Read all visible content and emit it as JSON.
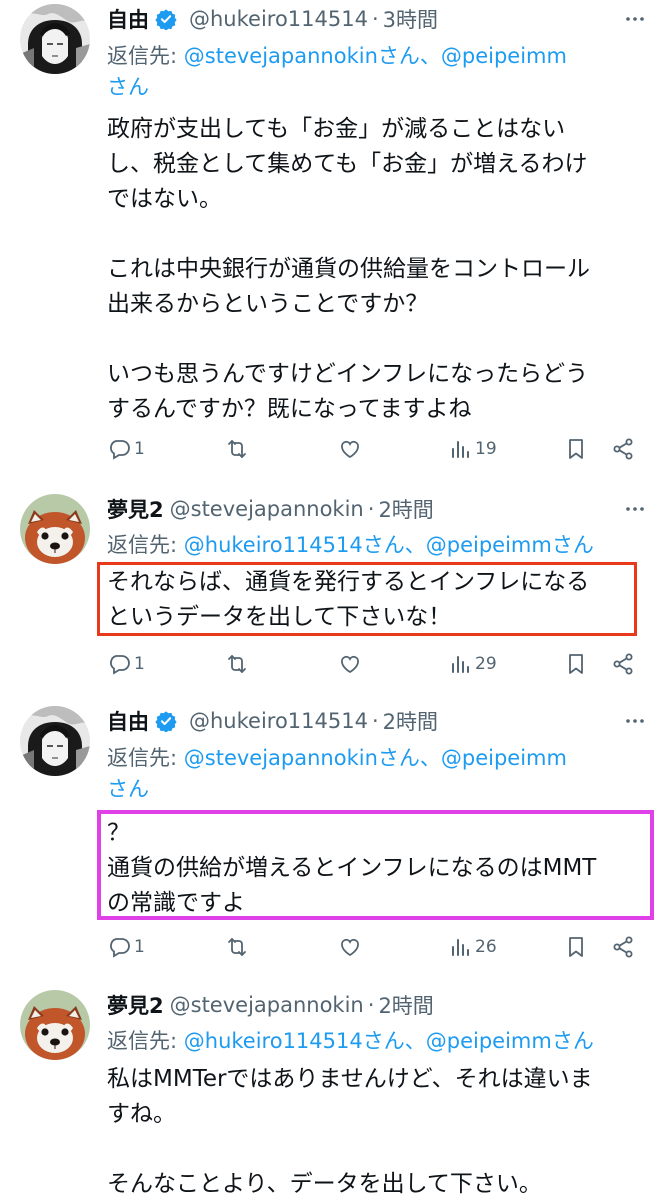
{
  "colors": {
    "accent": "#1d9bf0",
    "muted": "#536471",
    "text": "#0f1419",
    "highlight_red": "#e8391a",
    "highlight_pink": "#e040e8"
  },
  "tweets": [
    {
      "name": "自由",
      "handle": "@hukeiro114514",
      "sep": "·",
      "time": "3時間",
      "reply_prefix": "返信先: ",
      "reply_users": "@stevejapannokinさん、@peipeimm",
      "reply_suffix": "さん",
      "body": "政府が支出しても「お金」が減ることはない\nし、税金として集めても「お金」が増えるわけ\nではない。\n\nこれは中央銀行が通貨の供給量をコントロール\n出来るからということですか？\n\nいつも思うんですけどインフレになったらどう\nするんですか？既になってますよね",
      "replies": "1",
      "retweets": "",
      "likes": "",
      "views": "19",
      "avatar": "manga-character-avatar"
    },
    {
      "name": "夢見2",
      "handle": "@stevejapannokin",
      "sep": "·",
      "time": "2時間",
      "reply_prefix": "返信先: ",
      "reply_users": "@hukeiro114514さん、@peipeimmさん",
      "body": "それならば、通貨を発行するとインフレになる\nというデータを出して下さいな！",
      "replies": "1",
      "retweets": "",
      "likes": "",
      "views": "29",
      "avatar": "red-panda-avatar"
    },
    {
      "name": "自由",
      "handle": "@hukeiro114514",
      "sep": "·",
      "time": "2時間",
      "reply_prefix": "返信先: ",
      "reply_users": "@stevejapannokinさん、@peipeimm",
      "reply_suffix": "さん",
      "body": "？\n通貨の供給が増えるとインフレになるのはMMT\nの常識ですよ",
      "replies": "1",
      "retweets": "",
      "likes": "",
      "views": "26",
      "avatar": "manga-character-avatar"
    },
    {
      "name": "夢見2",
      "handle": "@stevejapannokin",
      "sep": "·",
      "time": "2時間",
      "reply_prefix": "返信先: ",
      "reply_users": "@hukeiro114514さん、@peipeimmさん",
      "body": "私はMMTerではありませんけど、それは違いま\nすね。\n\nそんなことより、データを出して下さい。",
      "avatar": "red-panda-avatar"
    }
  ]
}
